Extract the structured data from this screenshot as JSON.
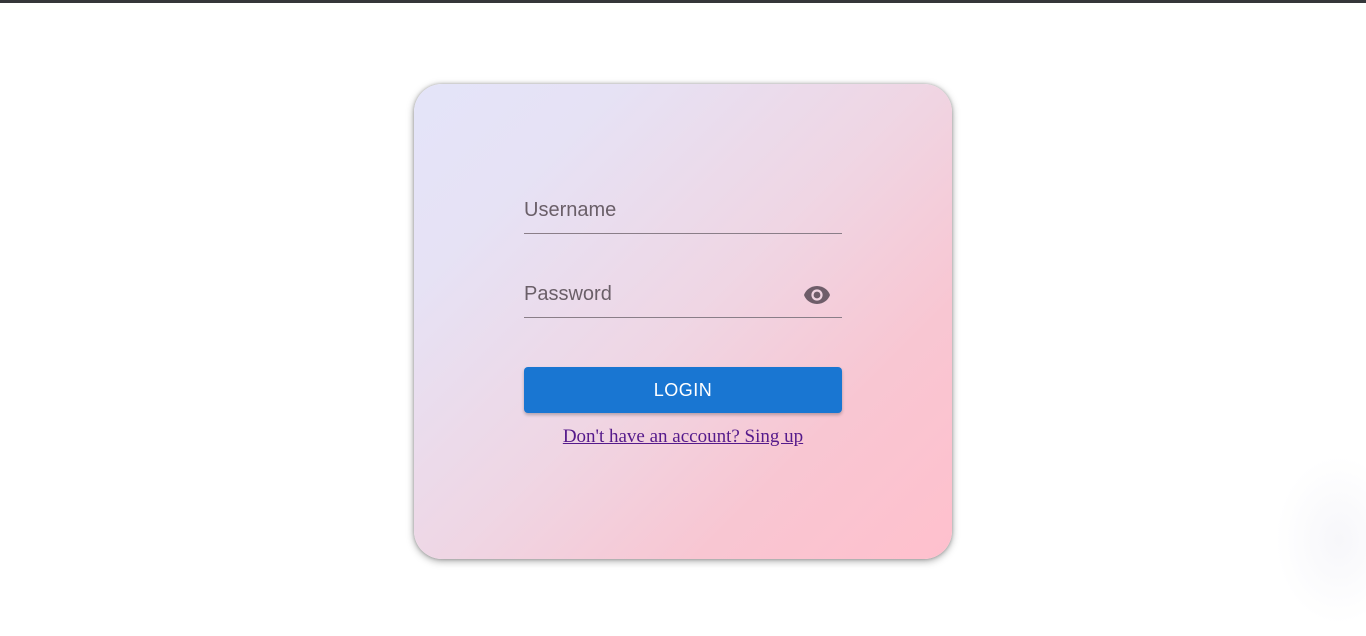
{
  "login_form": {
    "username": {
      "placeholder": "Username",
      "value": ""
    },
    "password": {
      "placeholder": "Password",
      "value": "",
      "toggle_icon": "eye-icon"
    },
    "login_button_label": "LOGIN",
    "signup_link_text": "Don't have an account? Sing up"
  },
  "colors": {
    "primary_button": "#1976d2",
    "link_visited": "#551a8b",
    "card_gradient_start": "#e4e4f9",
    "card_gradient_end": "#ffc0cd",
    "top_bar": "#35363a"
  }
}
